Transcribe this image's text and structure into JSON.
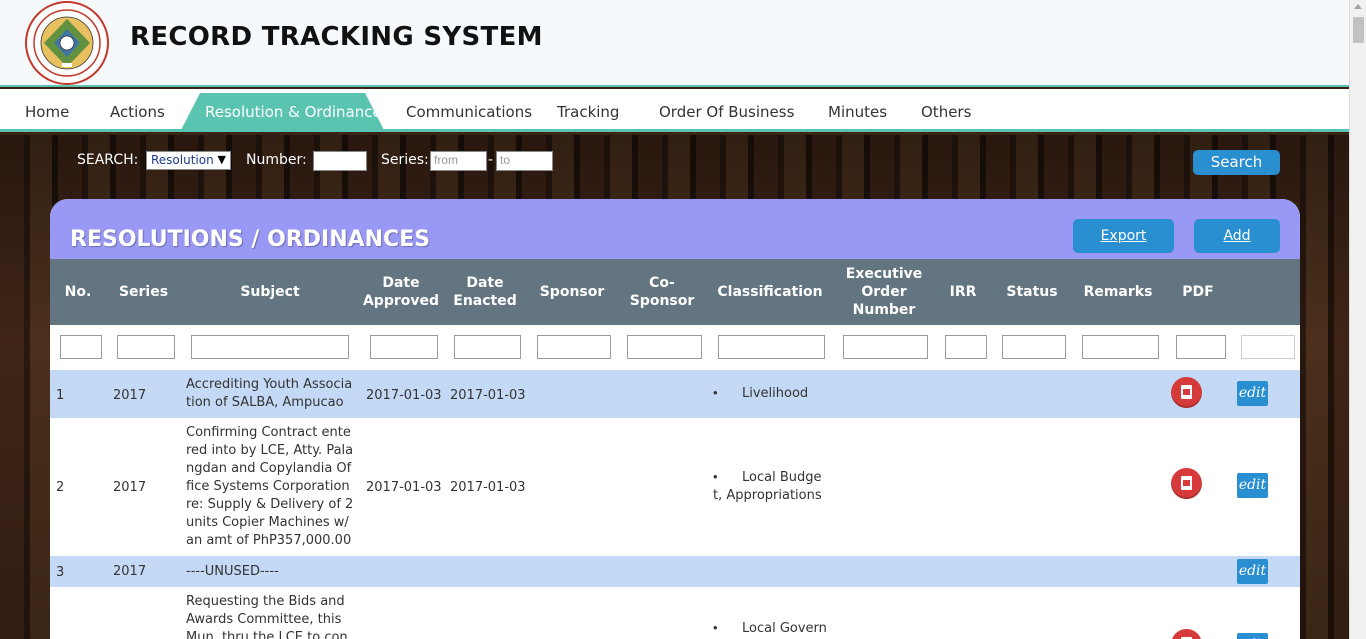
{
  "header": {
    "title": "RECORD TRACKING SYSTEM",
    "logo_text_top": "MUNICIPALITY OF ITOGON",
    "logo_text_bottom": "PROVINCE OF BENGUET",
    "logo_year": "1953"
  },
  "nav": {
    "items": [
      "Home",
      "Actions",
      "Resolution & Ordinance",
      "Communications",
      "Tracking",
      "Order Of Business",
      "Minutes",
      "Others"
    ],
    "active": "Resolution & Ordinance"
  },
  "search": {
    "label": "SEARCH:",
    "type_selected": "Resolution",
    "number_label": "Number:",
    "number_value": "",
    "series_label": "Series:",
    "from_placeholder": "from",
    "to_placeholder": "to",
    "dash": "-",
    "button": "Search"
  },
  "panel": {
    "title": "RESOLUTIONS / ORDINANCES",
    "export_label": "Export",
    "add_label": "Add"
  },
  "table": {
    "columns": [
      "No.",
      "Series",
      "Subject",
      "Date Approved",
      "Date Enacted",
      "Sponsor",
      "Co-Sponsor",
      "Classification",
      "Executive Order Number",
      "IRR",
      "Status",
      "Remarks",
      "PDF"
    ],
    "rows": [
      {
        "no": "1",
        "series": "2017",
        "subject": "Accrediting Youth Association of SALBA, Ampucao",
        "date_approved": "2017-01-03",
        "date_enacted": "2017-01-03",
        "classification": "Livelihood",
        "has_pdf": true,
        "edit": "edit"
      },
      {
        "no": "2",
        "series": "2017",
        "subject": "Confirming Contract entered into by LCE, Atty. Palangdan and Copylandia Office Systems Corporation re: Supply & Delivery of 2 units Copier Machines w/ an amt of PhP357,000.00",
        "date_approved": "2017-01-03",
        "date_enacted": "2017-01-03",
        "classification": "Local Budget, Appropriations",
        "has_pdf": true,
        "edit": "edit"
      },
      {
        "no": "3",
        "series": "2017",
        "subject": "----UNUSED----",
        "date_approved": "",
        "date_enacted": "",
        "classification": "",
        "has_pdf": false,
        "edit": "edit"
      },
      {
        "no": "",
        "series": "",
        "subject": "Requesting the Bids and Awards Committee, this Mun. thru the LCE to consider",
        "date_approved": "",
        "date_enacted": "",
        "classification": "Local Govern",
        "has_pdf": true,
        "edit": "edit"
      }
    ]
  },
  "colors": {
    "accent": "#5bc4b1",
    "panel_head": "#9999f5",
    "table_head": "#637580",
    "button_blue": "#2a8fd0",
    "row_blue": "#c4d9f5",
    "pdf_red": "#d63a3a"
  }
}
